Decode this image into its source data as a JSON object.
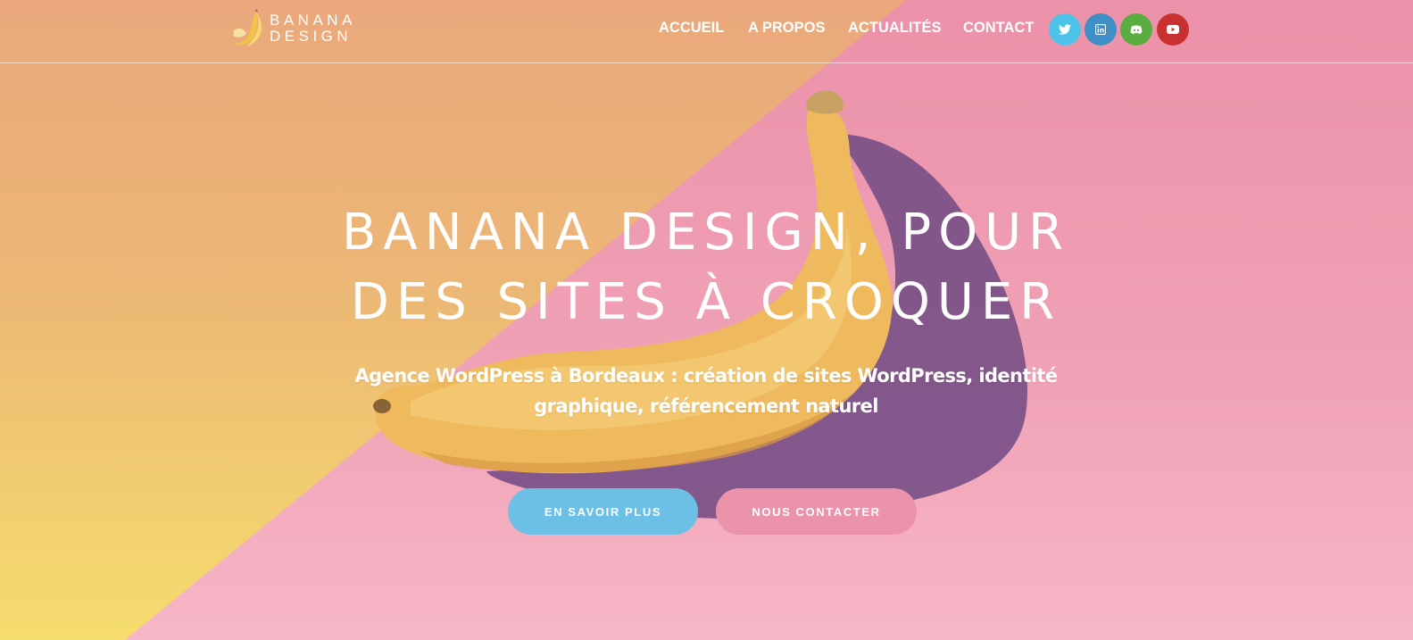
{
  "header": {
    "logo": {
      "line1": "BANANA",
      "line2": "DESIGN"
    },
    "nav": [
      {
        "label": "ACCUEIL"
      },
      {
        "label": "A PROPOS"
      },
      {
        "label": "ACTUALITÉS"
      },
      {
        "label": "CONTACT"
      }
    ],
    "social": [
      {
        "icon": "twitter-icon",
        "color": "#4dc3ea"
      },
      {
        "icon": "linkedin-icon",
        "color": "#3d8fc6"
      },
      {
        "icon": "discord-icon",
        "color": "#5aae3f"
      },
      {
        "icon": "youtube-icon",
        "color": "#c93130"
      }
    ]
  },
  "hero": {
    "title_line1": "BANANA DESIGN, POUR",
    "title_line2": "DES SITES À CROQUER",
    "subtitle_line1": "Agence WordPress à Bordeaux : création de sites WordPress, identité",
    "subtitle_line2": "graphique, référencement naturel",
    "primary_button": "EN SAVOIR PLUS",
    "secondary_button": "NOUS CONTACTER"
  },
  "colors": {
    "pink_background": "#eb91a9",
    "orange_background": "#eaa87c",
    "yellow_background": "#f5dd6d",
    "primary_button": "#6cc0e6",
    "secondary_button": "#eb93ab"
  }
}
